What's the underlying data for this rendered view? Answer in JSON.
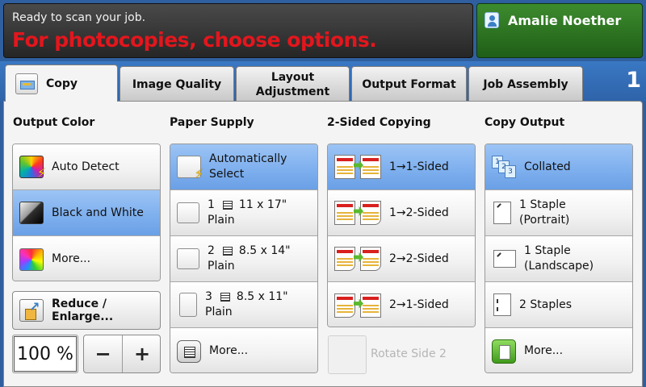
{
  "status": {
    "ready": "Ready to scan your job.",
    "message": "For photocopies, choose options."
  },
  "user": {
    "name": "Amalie Noether"
  },
  "copy_count": "1",
  "tabs": [
    {
      "label": "Copy",
      "active": true
    },
    {
      "label": "Image Quality"
    },
    {
      "label": "Layout\nAdjustment"
    },
    {
      "label": "Output Format"
    },
    {
      "label": "Job Assembly"
    }
  ],
  "output_color": {
    "header": "Output Color",
    "items": [
      "Auto Detect",
      "Black and White",
      "More..."
    ],
    "selected": "Black and White"
  },
  "reduce_enlarge": {
    "label": "Reduce / Enlarge...",
    "value": "100 %",
    "minus": "−",
    "plus": "+"
  },
  "paper_supply": {
    "header": "Paper Supply",
    "auto": "Automatically\nSelect",
    "trays": [
      {
        "num": "1",
        "size": "11 x 17\"",
        "type": "Plain"
      },
      {
        "num": "2",
        "size": "8.5 x 14\"",
        "type": "Plain"
      },
      {
        "num": "3",
        "size": "8.5 x 11\"",
        "type": "Plain"
      }
    ],
    "more": "More..."
  },
  "two_sided": {
    "header": "2-Sided Copying",
    "items": [
      "1→1-Sided",
      "1→2-Sided",
      "2→2-Sided",
      "2→1-Sided"
    ],
    "selected": "1→1-Sided",
    "rotate": "Rotate Side 2"
  },
  "copy_output": {
    "header": "Copy Output",
    "collated": "Collated",
    "staple_portrait": "1 Staple\n(Portrait)",
    "staple_landscape": "1 Staple\n(Landscape)",
    "two_staples": "2 Staples",
    "more": "More...",
    "selected": "Collated"
  },
  "colors": {
    "selected": "#7fb0ee",
    "alert": "#e3161d",
    "user": "#2f7a24",
    "band": "#3a78c4"
  }
}
